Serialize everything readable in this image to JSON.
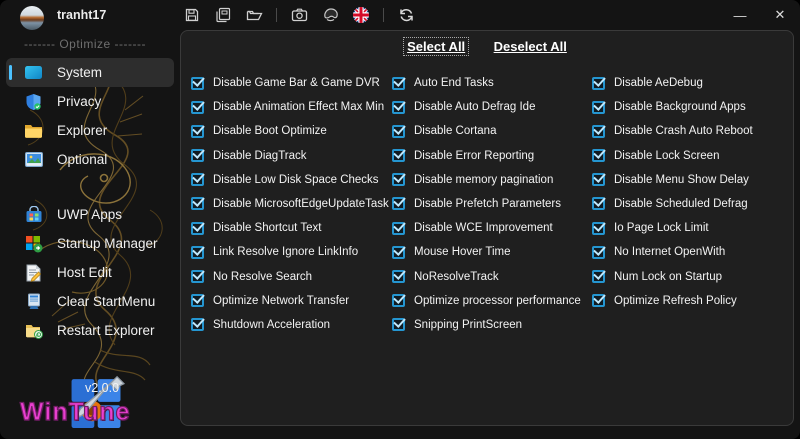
{
  "window": {
    "user": "tranht17",
    "minimize_glyph": "—",
    "close_glyph": "✕"
  },
  "toolbar": {
    "icons": [
      {
        "name": "save-icon"
      },
      {
        "name": "save-all-icon"
      },
      {
        "name": "open-folder-icon"
      },
      {
        "name": "screenshot-camera-icon"
      },
      {
        "name": "theme-icon"
      },
      {
        "name": "language-uk-flag-icon"
      },
      {
        "name": "refresh-icon"
      }
    ]
  },
  "sidebar": {
    "section_label": "------- Optimize -------",
    "items": [
      {
        "label": "System",
        "icon": "system",
        "selected": true,
        "gap": false
      },
      {
        "label": "Privacy",
        "icon": "privacy",
        "selected": false,
        "gap": false
      },
      {
        "label": "Explorer",
        "icon": "explorer",
        "selected": false,
        "gap": false
      },
      {
        "label": "Optional",
        "icon": "optional",
        "selected": false,
        "gap": false
      },
      {
        "label": "UWP Apps",
        "icon": "uwp",
        "selected": false,
        "gap": true
      },
      {
        "label": "Startup Manager",
        "icon": "startup",
        "selected": false,
        "gap": false
      },
      {
        "label": "Host Edit",
        "icon": "hostedit",
        "selected": false,
        "gap": false
      },
      {
        "label": "Clear StartMenu",
        "icon": "clearstart",
        "selected": false,
        "gap": false
      },
      {
        "label": "Restart Explorer",
        "icon": "restartexp",
        "selected": false,
        "gap": false
      }
    ],
    "footer": {
      "version": "v2.0.0",
      "brand": "WinTune"
    }
  },
  "main": {
    "select_all_label": "Select All",
    "deselect_all_label": "Deselect All",
    "columns": [
      {
        "items": [
          "Disable Game Bar & Game DVR",
          "Disable Animation Effect Max Min",
          "Disable Boot Optimize",
          "Disable DiagTrack",
          "Disable Low Disk Space Checks",
          "Disable MicrosoftEdgeUpdateTask",
          "Disable Shortcut Text",
          "Link Resolve Ignore LinkInfo",
          "No Resolve Search",
          "Optimize Network Transfer",
          "Shutdown Acceleration"
        ]
      },
      {
        "items": [
          "Auto End Tasks",
          "Disable Auto Defrag Ide",
          "Disable Cortana",
          "Disable Error Reporting",
          "Disable memory pagination",
          "Disable Prefetch Parameters",
          "Disable WCE Improvement",
          "Mouse Hover Time",
          "NoResolveTrack",
          "Optimize processor performance",
          "Snipping PrintScreen"
        ]
      },
      {
        "items": [
          "Disable AeDebug",
          "Disable Background Apps",
          "Disable Crash Auto Reboot",
          "Disable Lock Screen",
          "Disable Menu Show Delay",
          "Disable Scheduled Defrag",
          "Io Page Lock Limit",
          "No Internet OpenWith",
          "Num Lock on Startup",
          "Optimize Refresh Policy"
        ]
      }
    ],
    "all_checked": true
  },
  "colors": {
    "accent": "#4cc2ff",
    "checkbox_border": "#2596d1",
    "panel_bg": "#1f1f1f",
    "window_bg": "#141414",
    "brand_magenta": "#e93fd0"
  }
}
